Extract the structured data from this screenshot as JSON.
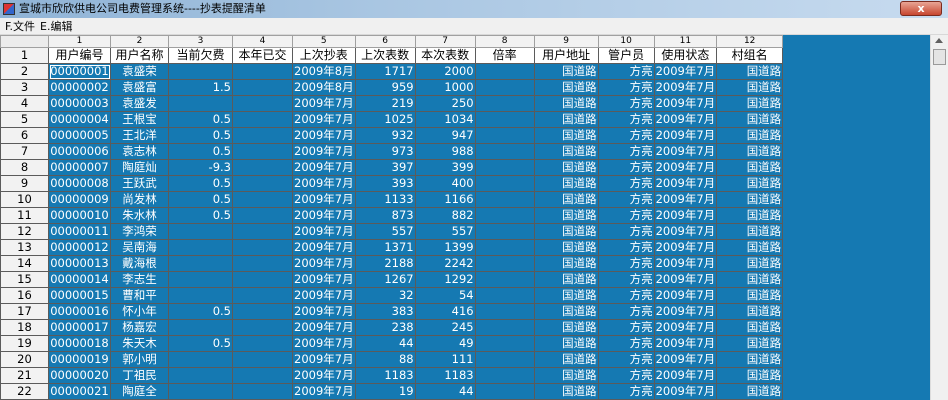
{
  "window": {
    "title": "宣城市欣欣供电公司电费管理系统----抄表提醒清单",
    "close_label": "x"
  },
  "menu": [
    {
      "label": "F.文件"
    },
    {
      "label": "E.编辑"
    }
  ],
  "grid": {
    "column_numbers": [
      "1",
      "2",
      "3",
      "4",
      "5",
      "6",
      "7",
      "8",
      "9",
      "10",
      "11",
      "12"
    ],
    "headers": [
      "用户编号",
      "用户名称",
      "当前欠费",
      "本年已交",
      "上次抄表",
      "上次表数",
      "本次表数",
      "倍率",
      "用户地址",
      "管户员",
      "使用状态",
      "村组名"
    ],
    "rows": [
      {
        "n": "2",
        "id": "00000001",
        "name": "袁盛荣",
        "debt": "",
        "paid": "",
        "last": "2009年8月",
        "prev": "1717",
        "curr": "2000",
        "rate": "",
        "addr": "国道路",
        "mgr": "方亮",
        "status": "2009年7月",
        "village": "国道路"
      },
      {
        "n": "3",
        "id": "00000002",
        "name": "袁盛富",
        "debt": "1.5",
        "paid": "",
        "last": "2009年8月",
        "prev": "959",
        "curr": "1000",
        "rate": "",
        "addr": "国道路",
        "mgr": "方亮",
        "status": "2009年7月",
        "village": "国道路"
      },
      {
        "n": "4",
        "id": "00000003",
        "name": "袁盛发",
        "debt": "",
        "paid": "",
        "last": "2009年7月",
        "prev": "219",
        "curr": "250",
        "rate": "",
        "addr": "国道路",
        "mgr": "方亮",
        "status": "2009年7月",
        "village": "国道路"
      },
      {
        "n": "5",
        "id": "00000004",
        "name": "王根宝",
        "debt": "0.5",
        "paid": "",
        "last": "2009年7月",
        "prev": "1025",
        "curr": "1034",
        "rate": "",
        "addr": "国道路",
        "mgr": "方亮",
        "status": "2009年7月",
        "village": "国道路"
      },
      {
        "n": "6",
        "id": "00000005",
        "name": "王北洋",
        "debt": "0.5",
        "paid": "",
        "last": "2009年7月",
        "prev": "932",
        "curr": "947",
        "rate": "",
        "addr": "国道路",
        "mgr": "方亮",
        "status": "2009年7月",
        "village": "国道路"
      },
      {
        "n": "7",
        "id": "00000006",
        "name": "袁志林",
        "debt": "0.5",
        "paid": "",
        "last": "2009年7月",
        "prev": "973",
        "curr": "988",
        "rate": "",
        "addr": "国道路",
        "mgr": "方亮",
        "status": "2009年7月",
        "village": "国道路"
      },
      {
        "n": "8",
        "id": "00000007",
        "name": "陶庭灿",
        "debt": "-9.3",
        "paid": "",
        "last": "2009年7月",
        "prev": "397",
        "curr": "399",
        "rate": "",
        "addr": "国道路",
        "mgr": "方亮",
        "status": "2009年7月",
        "village": "国道路"
      },
      {
        "n": "9",
        "id": "00000008",
        "name": "王跃武",
        "debt": "0.5",
        "paid": "",
        "last": "2009年7月",
        "prev": "393",
        "curr": "400",
        "rate": "",
        "addr": "国道路",
        "mgr": "方亮",
        "status": "2009年7月",
        "village": "国道路"
      },
      {
        "n": "10",
        "id": "00000009",
        "name": "尚发林",
        "debt": "0.5",
        "paid": "",
        "last": "2009年7月",
        "prev": "1133",
        "curr": "1166",
        "rate": "",
        "addr": "国道路",
        "mgr": "方亮",
        "status": "2009年7月",
        "village": "国道路"
      },
      {
        "n": "11",
        "id": "00000010",
        "name": "朱水林",
        "debt": "0.5",
        "paid": "",
        "last": "2009年7月",
        "prev": "873",
        "curr": "882",
        "rate": "",
        "addr": "国道路",
        "mgr": "方亮",
        "status": "2009年7月",
        "village": "国道路"
      },
      {
        "n": "12",
        "id": "00000011",
        "name": "李鸿荣",
        "debt": "",
        "paid": "",
        "last": "2009年7月",
        "prev": "557",
        "curr": "557",
        "rate": "",
        "addr": "国道路",
        "mgr": "方亮",
        "status": "2009年7月",
        "village": "国道路"
      },
      {
        "n": "13",
        "id": "00000012",
        "name": "吴南海",
        "debt": "",
        "paid": "",
        "last": "2009年7月",
        "prev": "1371",
        "curr": "1399",
        "rate": "",
        "addr": "国道路",
        "mgr": "方亮",
        "status": "2009年7月",
        "village": "国道路"
      },
      {
        "n": "14",
        "id": "00000013",
        "name": "戴海根",
        "debt": "",
        "paid": "",
        "last": "2009年7月",
        "prev": "2188",
        "curr": "2242",
        "rate": "",
        "addr": "国道路",
        "mgr": "方亮",
        "status": "2009年7月",
        "village": "国道路"
      },
      {
        "n": "15",
        "id": "00000014",
        "name": "李志生",
        "debt": "",
        "paid": "",
        "last": "2009年7月",
        "prev": "1267",
        "curr": "1292",
        "rate": "",
        "addr": "国道路",
        "mgr": "方亮",
        "status": "2009年7月",
        "village": "国道路"
      },
      {
        "n": "16",
        "id": "00000015",
        "name": "曹和平",
        "debt": "",
        "paid": "",
        "last": "2009年7月",
        "prev": "32",
        "curr": "54",
        "rate": "",
        "addr": "国道路",
        "mgr": "方亮",
        "status": "2009年7月",
        "village": "国道路"
      },
      {
        "n": "17",
        "id": "00000016",
        "name": "怀小年",
        "debt": "0.5",
        "paid": "",
        "last": "2009年7月",
        "prev": "383",
        "curr": "416",
        "rate": "",
        "addr": "国道路",
        "mgr": "方亮",
        "status": "2009年7月",
        "village": "国道路"
      },
      {
        "n": "18",
        "id": "00000017",
        "name": "杨嘉宏",
        "debt": "",
        "paid": "",
        "last": "2009年7月",
        "prev": "238",
        "curr": "245",
        "rate": "",
        "addr": "国道路",
        "mgr": "方亮",
        "status": "2009年7月",
        "village": "国道路"
      },
      {
        "n": "19",
        "id": "00000018",
        "name": "朱天木",
        "debt": "0.5",
        "paid": "",
        "last": "2009年7月",
        "prev": "44",
        "curr": "49",
        "rate": "",
        "addr": "国道路",
        "mgr": "方亮",
        "status": "2009年7月",
        "village": "国道路"
      },
      {
        "n": "20",
        "id": "00000019",
        "name": "郭小明",
        "debt": "",
        "paid": "",
        "last": "2009年7月",
        "prev": "88",
        "curr": "111",
        "rate": "",
        "addr": "国道路",
        "mgr": "方亮",
        "status": "2009年7月",
        "village": "国道路"
      },
      {
        "n": "21",
        "id": "00000020",
        "name": "丁祖民",
        "debt": "",
        "paid": "",
        "last": "2009年7月",
        "prev": "1183",
        "curr": "1183",
        "rate": "",
        "addr": "国道路",
        "mgr": "方亮",
        "status": "2009年7月",
        "village": "国道路"
      },
      {
        "n": "22",
        "id": "00000021",
        "name": "陶庭全",
        "debt": "",
        "paid": "",
        "last": "2009年7月",
        "prev": "19",
        "curr": "44",
        "rate": "",
        "addr": "国道路",
        "mgr": "方亮",
        "status": "2009年7月",
        "village": "国道路"
      }
    ]
  },
  "colors": {
    "grid_background": "#1579b2",
    "header_background": "#ffffff",
    "cell_text": "#ffffff"
  },
  "icons": {
    "app": "app-icon",
    "close": "close-icon",
    "scroll_up": "scroll-up-icon"
  }
}
